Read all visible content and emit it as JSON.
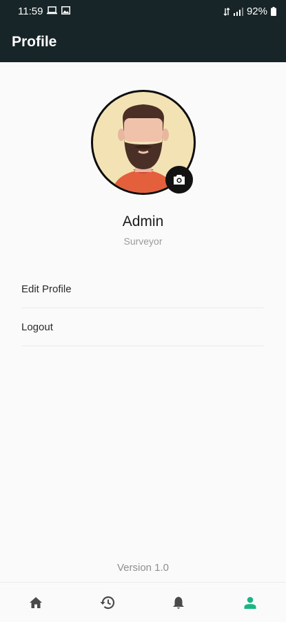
{
  "status_bar": {
    "time": "11:59",
    "battery": "92%",
    "icons_left": [
      "laptop-icon",
      "image-icon"
    ],
    "icons_right": [
      "data-icon",
      "signal-icon",
      "battery-icon"
    ]
  },
  "app_bar": {
    "title": "Profile"
  },
  "profile": {
    "name": "Admin",
    "role": "Surveyor",
    "avatar_icon": "bearded-man-avatar",
    "camera_icon": "camera-icon"
  },
  "menu": {
    "items": [
      {
        "label": "Edit Profile"
      },
      {
        "label": "Logout"
      }
    ]
  },
  "footer": {
    "version": "Version 1.0"
  },
  "bottom_nav": {
    "items": [
      {
        "icon": "home-icon",
        "active": false
      },
      {
        "icon": "history-icon",
        "active": false
      },
      {
        "icon": "bell-icon",
        "active": false
      },
      {
        "icon": "person-icon",
        "active": true
      }
    ]
  },
  "colors": {
    "app_bar": "#172528",
    "accent": "#1ab583",
    "inactive_icon": "#4a4a4a"
  }
}
